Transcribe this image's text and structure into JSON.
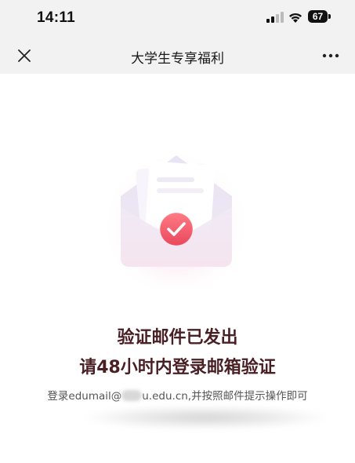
{
  "status_bar": {
    "time": "14:11",
    "battery": "67"
  },
  "nav": {
    "title": "大学生专享福利",
    "close_icon": "close-icon",
    "more_icon": "more-icon"
  },
  "main": {
    "illustration_icon": "envelope-check-icon",
    "headline_1": "验证邮件已发出",
    "headline_2": "请48小时内登录邮箱验证",
    "instruction_prefix": "登录edumail@",
    "instruction_suffix": "u.edu.cn,并按照邮件提示操作即可"
  },
  "colors": {
    "bar_bg": "#f2f2f2",
    "headline": "#4a1f24",
    "check_badge": "#ef5a6a"
  }
}
